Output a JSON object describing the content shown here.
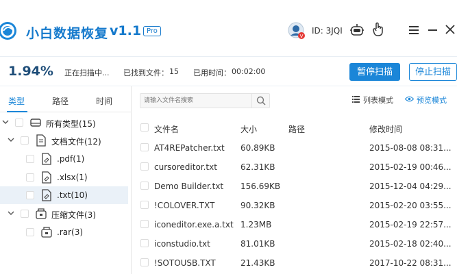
{
  "app": {
    "title": "小白数据恢复",
    "version": "v1.1",
    "badge": "Pro",
    "user_id": "ID: 3JQI"
  },
  "scan": {
    "progress": "1.94%",
    "status": "正在扫描中...",
    "found_label": "已找到文件：",
    "found_count": "15",
    "elapsed_label": "已用时间：",
    "elapsed": "00:02:00",
    "pause_label": "暂停扫描",
    "stop_label": "停止扫描"
  },
  "left": {
    "tabs": [
      "类型",
      "路径",
      "时间"
    ],
    "tree": [
      {
        "label": "所有类型(15)",
        "level": 0,
        "expanded": true,
        "icon": "drive-icon"
      },
      {
        "label": "文档文件(12)",
        "level": 1,
        "expanded": true,
        "icon": "document-icon"
      },
      {
        "label": ".pdf(1)",
        "level": 2,
        "icon": "file-icon"
      },
      {
        "label": ".xlsx(1)",
        "level": 2,
        "icon": "file-icon"
      },
      {
        "label": ".txt(10)",
        "level": 2,
        "icon": "file-icon",
        "selected": true
      },
      {
        "label": "压缩文件(3)",
        "level": 1,
        "expanded": true,
        "icon": "archive-icon"
      },
      {
        "label": ".rar(3)",
        "level": 2,
        "icon": "archive-icon"
      }
    ]
  },
  "toolbar": {
    "search_placeholder": "请输入文件名搜索",
    "list_mode": "列表模式",
    "preview_mode": "预览模式"
  },
  "table": {
    "columns": [
      "文件名",
      "大小",
      "路径",
      "修改时间"
    ],
    "rows": [
      {
        "name": "AT4REPatcher.txt",
        "size": "60.89KB",
        "path": "",
        "time": "2015-08-08 08:31..."
      },
      {
        "name": "cursoreditor.txt",
        "size": "62.31KB",
        "path": "",
        "time": "2015-02-19 00:46..."
      },
      {
        "name": "Demo Builder.txt",
        "size": "156.69KB",
        "path": "",
        "time": "2015-12-04 04:29..."
      },
      {
        "name": "!COLOVER.TXT",
        "size": "90.32KB",
        "path": "",
        "time": "2015-02-20 03:55..."
      },
      {
        "name": "iconeditor.exe.a.txt",
        "size": "1.23MB",
        "path": "",
        "time": "2015-02-19 22:57..."
      },
      {
        "name": "iconstudio.txt",
        "size": "81.01KB",
        "path": "",
        "time": "2015-02-18 02:40..."
      },
      {
        "name": "!SOTOUSB.TXT",
        "size": "21.43KB",
        "path": "",
        "time": "2017-10-22 08:31..."
      }
    ]
  },
  "colors": {
    "accent": "#1b86d8",
    "title": "#1479cc",
    "progress": "#1f4e79",
    "selected_row": "#eaf1f8"
  }
}
